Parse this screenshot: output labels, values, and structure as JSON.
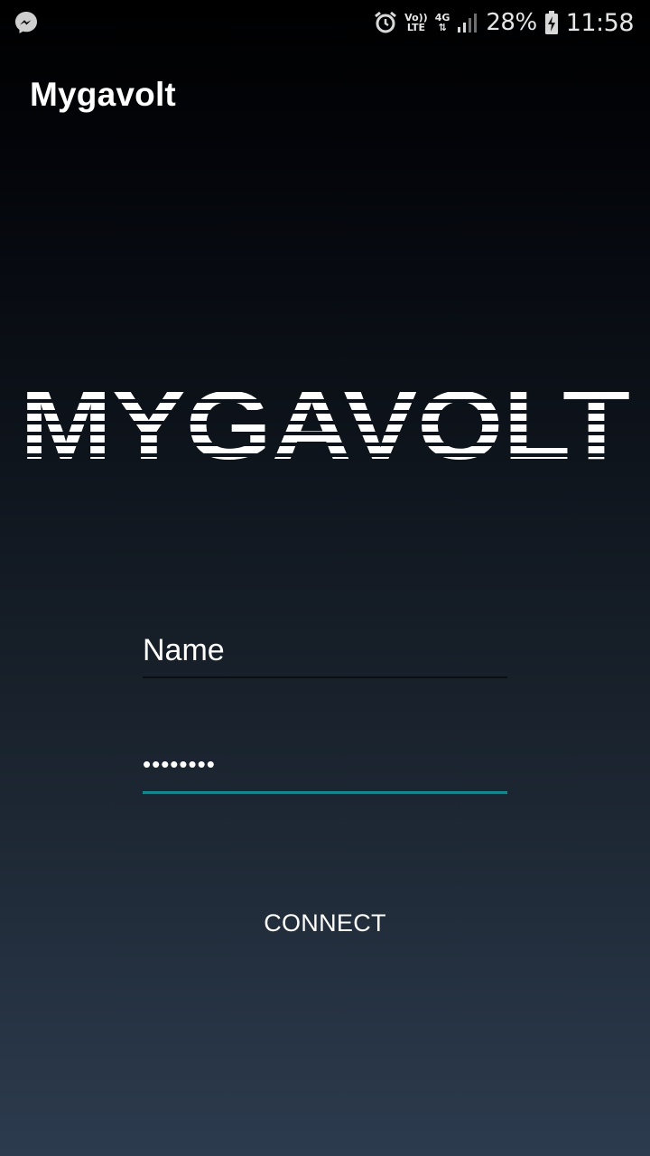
{
  "status_bar": {
    "left_icon": "messenger-icon",
    "alarm_icon": "alarm-icon",
    "volte_label_top": "Vo))",
    "volte_label_bottom": "LTE",
    "network_label": "4G",
    "signal_icon": "signal-icon",
    "battery_percent": "28%",
    "battery_icon": "battery-charging-icon",
    "time": "11:58"
  },
  "app_bar": {
    "title": "Mygavolt"
  },
  "logo": {
    "text": "MYGAVOLT",
    "color": "#ffffff"
  },
  "form": {
    "name_value": "Name",
    "password_value": "••••••••",
    "accent_color": "#15878f"
  },
  "actions": {
    "connect_label": "CONNECT"
  }
}
